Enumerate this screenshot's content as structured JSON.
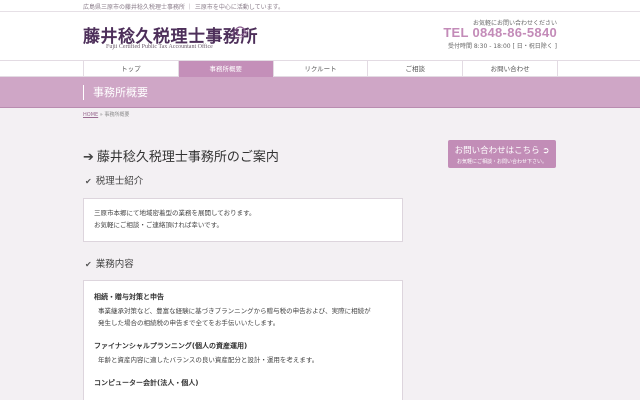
{
  "topbar": {
    "tagline": "広島県三原市の藤井稔久税理士事務所 ｜ 三原市を中心に活動しています。"
  },
  "header": {
    "logo_title": "藤井稔久税理士事務所",
    "logo_sub": "Fujii Certified Public Tax Accountant Office",
    "contact_lead": "お気軽にお問い合わせください",
    "tel": "TEL 0848-86-5840",
    "hours": "受付時間 8:30 - 18:00 [ 日・祝日除く ]"
  },
  "nav": {
    "items": [
      {
        "label": "トップ"
      },
      {
        "label": "事務所概要"
      },
      {
        "label": "リクルート"
      },
      {
        "label": "ご相談"
      },
      {
        "label": "お問い合わせ"
      }
    ]
  },
  "banner": {
    "title": "事務所概要"
  },
  "breadcrumb": {
    "home": "HOME",
    "sep": " » ",
    "current": "事務所概要"
  },
  "main": {
    "page_title": "藤井稔久税理士事務所のご案内",
    "section1": {
      "heading": "税理士紹介",
      "lines": [
        "三原市本郷にて地域密着型の業務を展開しております。",
        "お気軽にご相談・ご連絡頂ければ幸いです。"
      ]
    },
    "section2": {
      "heading": "業務内容",
      "items": [
        {
          "title": "相続・贈与対策と申告",
          "lines": [
            "事業継承対策など、豊富な経験に基づきプランニングから贈与税の申告および、実際に相続が",
            "発生した場合の相続税の申告まで全てをお手伝いいたします。"
          ]
        },
        {
          "title": "ファイナンシャルプランニング(個人の資産運用)",
          "lines": [
            "年齢と資産内容に適したバランスの良い資産配分と設計・運用を考えます。"
          ]
        },
        {
          "title": "コンピューター会計(法人・個人)",
          "lines": []
        }
      ]
    }
  },
  "side": {
    "contact_title": "お問い合わせはこちら",
    "contact_sub": "お気軽にご相談・お問い合わせ下さい。"
  },
  "colors": {
    "accent": "#c48fb9",
    "banner": "#cfa6c6",
    "logo": "#4d2f5a"
  }
}
